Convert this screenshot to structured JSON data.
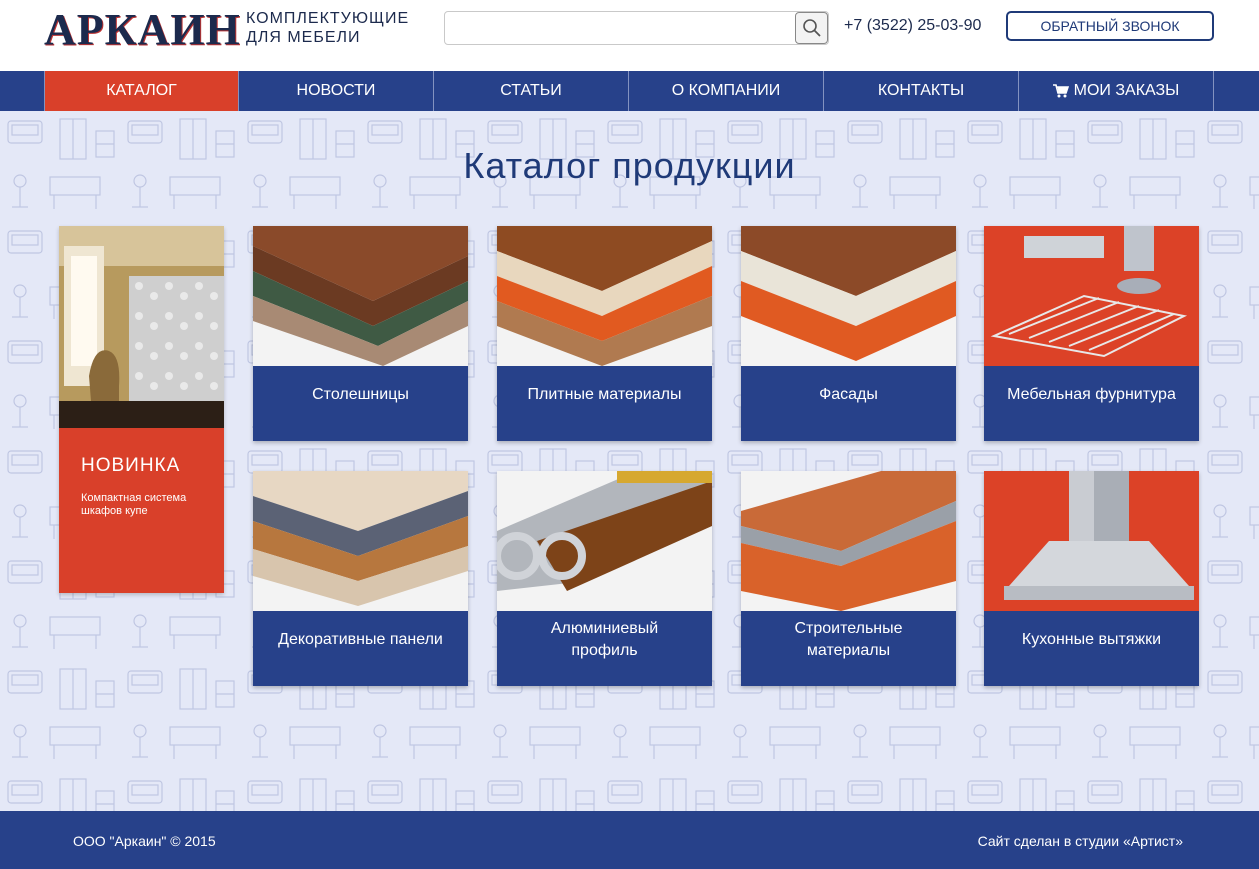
{
  "header": {
    "logo": "АРКАИН",
    "tagline_line1": "КОМПЛЕКТУЮЩИЕ",
    "tagline_line2": "ДЛЯ МЕБЕЛИ",
    "search_value": "",
    "search_placeholder": "",
    "phone": "+7 (3522) 25-03-90",
    "callback_label": "ОБРАТНЫЙ ЗВОНОК"
  },
  "nav": {
    "items": [
      {
        "label": "КАТАЛОГ",
        "active": true
      },
      {
        "label": "НОВОСТИ"
      },
      {
        "label": "СТАТЬИ"
      },
      {
        "label": "О КОМПАНИИ"
      },
      {
        "label": "КОНТАКТЫ"
      },
      {
        "label": "МОИ ЗАКАЗЫ",
        "icon": "cart-icon"
      }
    ]
  },
  "main": {
    "title": "Каталог продукции",
    "promo": {
      "title": "НОВИНКА",
      "text": "Компактная система шкафов купе"
    },
    "cards": [
      {
        "label": "Столешницы"
      },
      {
        "label": "Плитные материалы"
      },
      {
        "label": "Фасады"
      },
      {
        "label": "Мебельная фурнитура"
      },
      {
        "label": "Декоративные панели"
      },
      {
        "label": "Алюминиевый профиль"
      },
      {
        "label": "Строительные материалы"
      },
      {
        "label": "Кухонные вытяжки"
      }
    ]
  },
  "footer": {
    "copyright": "ООО \"Аркаин\" © 2015",
    "credit": "Сайт сделан в студии «Артист»"
  },
  "colors": {
    "brand_blue": "#27418a",
    "accent_red": "#d9402a",
    "background": "#e4e8f7"
  }
}
